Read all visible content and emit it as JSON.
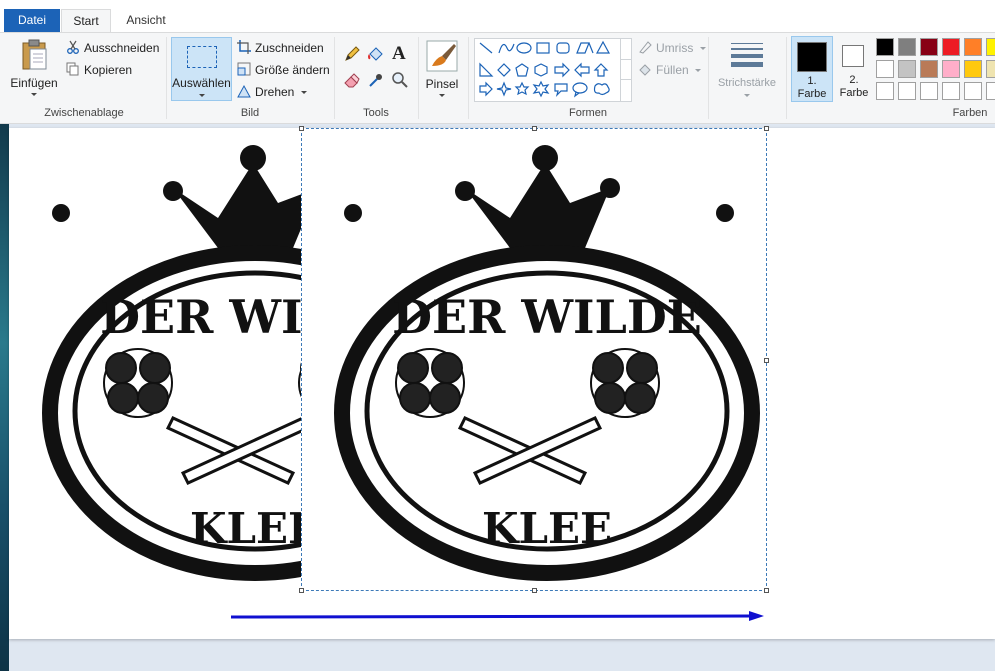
{
  "tabs": [
    {
      "label": "Datei"
    },
    {
      "label": "Start"
    },
    {
      "label": "Ansicht"
    }
  ],
  "groups": {
    "clipboard": {
      "label": "Zwischenablage",
      "paste": "Einfügen",
      "cut": "Ausschneiden",
      "copy": "Kopieren"
    },
    "image": {
      "label": "Bild",
      "select": "Auswählen",
      "crop": "Zuschneiden",
      "resize": "Größe ändern",
      "rotate": "Drehen"
    },
    "tools": {
      "label": "Tools"
    },
    "brushes": {
      "label": "Pinsel"
    },
    "shapes": {
      "label": "Formen",
      "outline": "Umriss",
      "fill": "Füllen"
    },
    "size": {
      "label": "Strichstärke"
    },
    "colors": {
      "label": "Farben",
      "color1": "1.\nFarbe",
      "color1_line1": "1.",
      "color1_line2": "Farbe",
      "color2_line1": "2.",
      "color2_line2": "Farbe"
    }
  },
  "palette": {
    "row1": [
      "#000000",
      "#7f7f7f",
      "#880015",
      "#ed1c24",
      "#ff7f27",
      "#fff200"
    ],
    "row2": [
      "#ffffff",
      "#c3c3c3",
      "#b97a57",
      "#ffaec9",
      "#ffc90e",
      "#efe4b0"
    ],
    "row3": [
      "#ffffff",
      "#ffffff",
      "#ffffff",
      "#ffffff",
      "#ffffff",
      "#ffffff"
    ],
    "color1": "#000000",
    "color2": "#ffffff"
  },
  "canvas": {
    "logo_top_text": "DER WILDE",
    "logo_bottom_text": "KLEE",
    "arrow_color": "#1010d0"
  }
}
